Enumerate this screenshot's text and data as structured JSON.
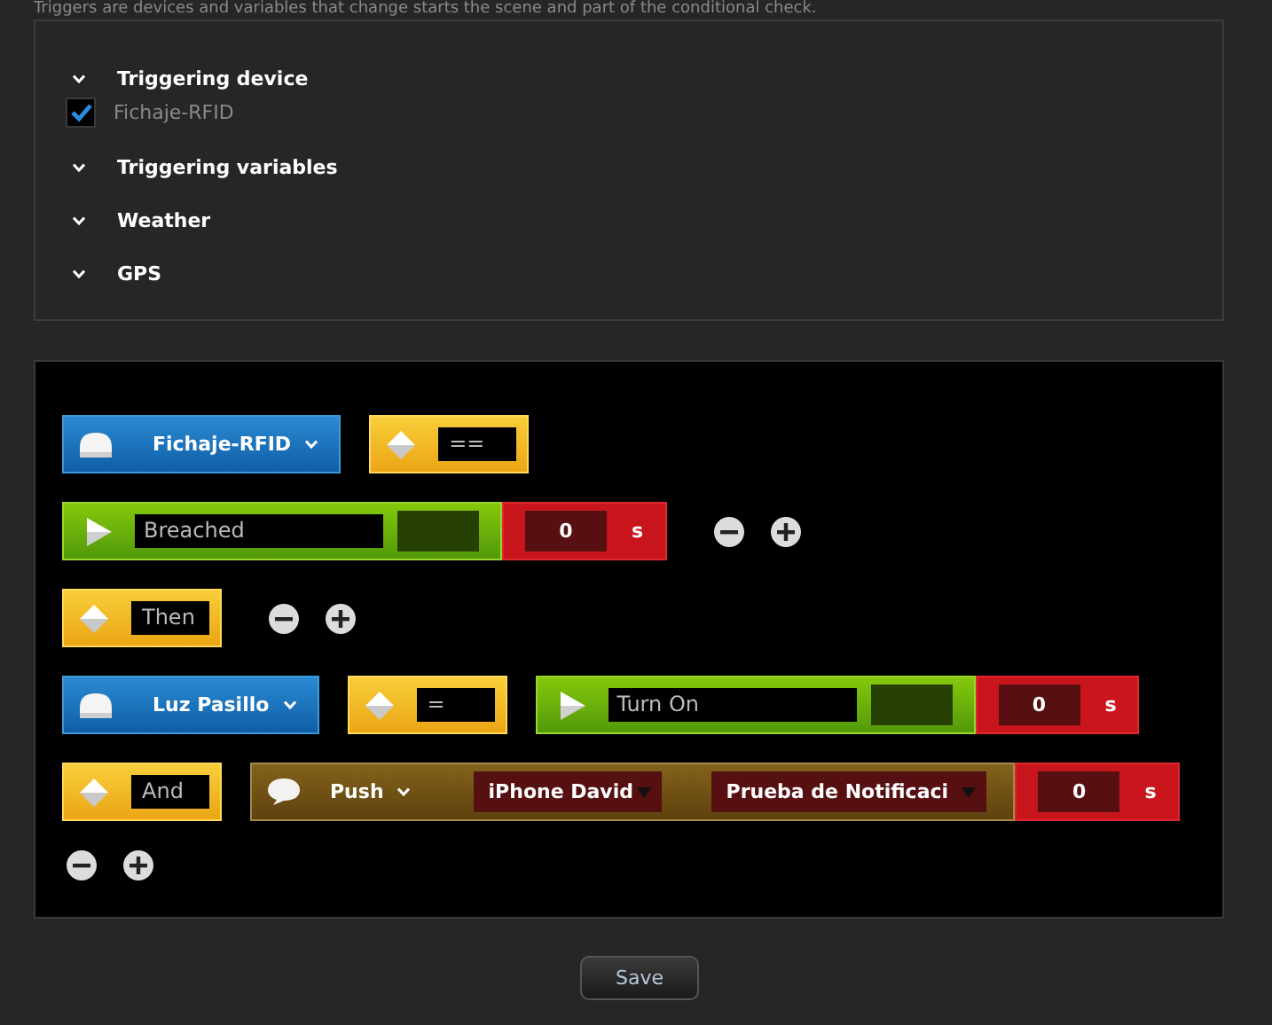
{
  "description": "Triggers are devices and variables that change starts the scene and part of the conditional check.",
  "triggers": [
    {
      "label": "Triggering device",
      "options": [
        {
          "label": "Fichaje-RFID",
          "checked": true
        }
      ]
    },
    {
      "label": "Triggering variables"
    },
    {
      "label": "Weather"
    },
    {
      "label": "GPS"
    }
  ],
  "scene_rows": [
    {
      "blocks": [
        {
          "kind": "device",
          "label": "Fichaje-RFID"
        },
        {
          "kind": "operator",
          "value": "=="
        }
      ]
    },
    {
      "blocks": [
        {
          "kind": "state",
          "value": "Breached"
        },
        {
          "kind": "delay",
          "value": "0",
          "unit": "s"
        },
        {
          "kind": "add_remove"
        }
      ]
    },
    {
      "blocks": [
        {
          "kind": "operator",
          "value": "Then"
        },
        {
          "kind": "add_remove"
        }
      ]
    },
    {
      "blocks": [
        {
          "kind": "device",
          "label": "Luz Pasillo"
        },
        {
          "kind": "operator",
          "value": "="
        },
        {
          "kind": "state",
          "value": "Turn On"
        },
        {
          "kind": "delay",
          "value": "0",
          "unit": "s"
        }
      ]
    },
    {
      "blocks": [
        {
          "kind": "operator",
          "value": "And"
        },
        {
          "kind": "push",
          "label": "Push",
          "target": "iPhone David",
          "message": "Prueba de Notificaci"
        },
        {
          "kind": "delay",
          "value": "0",
          "unit": "s"
        }
      ]
    },
    {
      "blocks": [
        {
          "kind": "add_remove"
        }
      ]
    }
  ],
  "save_button": "Save"
}
